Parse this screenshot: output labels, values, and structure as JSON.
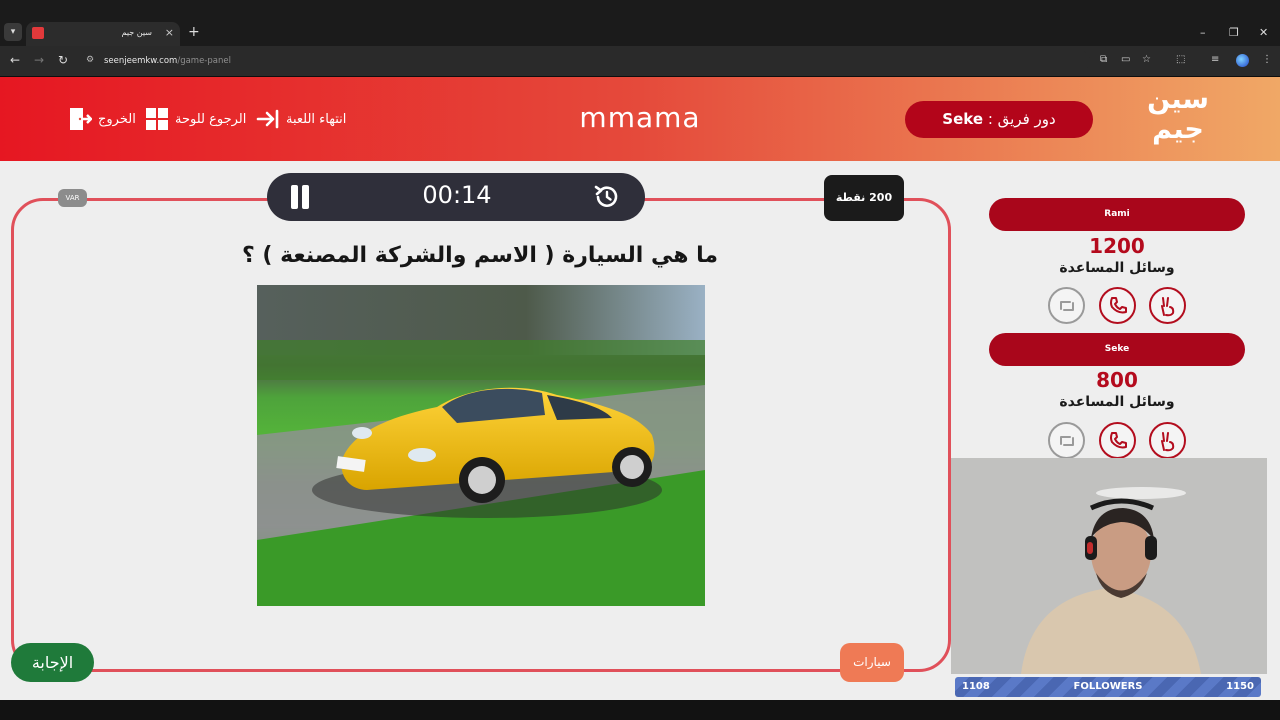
{
  "browser": {
    "tab_title": "سين جيم",
    "tab_close": "×",
    "new_tab": "+",
    "url_host": "seenjeemkw.com",
    "url_path": "/game-panel",
    "window_controls": {
      "minimize": "–",
      "restore": "❐",
      "close": "✕"
    },
    "nav": {
      "back": "←",
      "forward": "→",
      "reload": "↻"
    }
  },
  "header": {
    "logo_line1": "سين",
    "logo_line2": "جيم",
    "turn_label": "دور فريق :",
    "turn_team": "Seke",
    "game_name": "mmama",
    "end_game_label": "انتهاء اللعبة",
    "back_to_board_label": "الرجوع للوحة",
    "exit_label": "الخروج"
  },
  "question_panel": {
    "var_badge": "VAR",
    "timer": "00:14",
    "points": "200 نقطة",
    "question": "ما هي السيارة ( الاسم والشركة المصنعة ) ؟",
    "answer_button": "الإجابة",
    "category_button": "سيارات"
  },
  "teams": [
    {
      "name": "Rami",
      "score": "1200",
      "aids_label": "وسائل المساعدة"
    },
    {
      "name": "Seke",
      "score": "800",
      "aids_label": "وسائل المساعدة"
    }
  ],
  "stream_overlay": {
    "followers_label": "FOLLOWERS",
    "followers_current": "1108",
    "followers_goal": "1150"
  },
  "colors": {
    "header_start": "#e61722",
    "header_end": "#f0a866",
    "team_pill": "#a9061b",
    "answer_button": "#1f7a3a",
    "category_button": "#ef7a55",
    "timer_bg": "#2f2f3a"
  }
}
